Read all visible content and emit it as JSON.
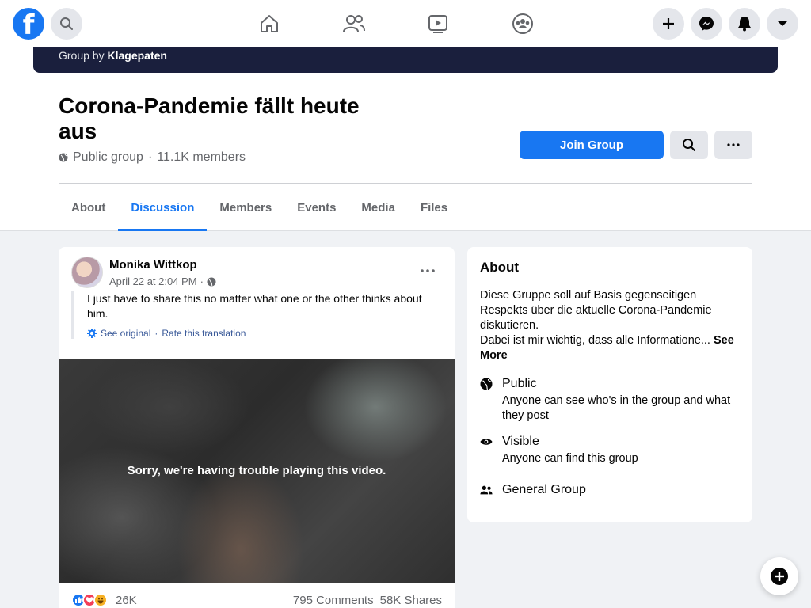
{
  "topbar": {
    "logo_letter": "f",
    "nav": [
      "home-icon",
      "friends-icon",
      "watch-icon",
      "groups-icon"
    ],
    "right": [
      "create-icon",
      "messenger-icon",
      "notifications-icon",
      "account-menu-icon"
    ]
  },
  "group": {
    "by_label": "Group by",
    "by_name": "Klagepaten",
    "title": "Corona-Pandemie fällt heute aus",
    "privacy": "Public group",
    "separator": "·",
    "members": "11.1K members",
    "join_label": "Join Group"
  },
  "tabs": [
    {
      "label": "About"
    },
    {
      "label": "Discussion",
      "active": true
    },
    {
      "label": "Members"
    },
    {
      "label": "Events"
    },
    {
      "label": "Media"
    },
    {
      "label": "Files"
    }
  ],
  "post": {
    "author": "Monika Wittkop",
    "time": "April 22 at 2:04 PM",
    "time_sep": "·",
    "text": "I just have to share this no matter what one or the other thinks about him.",
    "see_original": "See original",
    "translate_sep": "·",
    "rate_translation": "Rate this translation",
    "video_error": "Sorry, we're having trouble playing this video.",
    "reaction_count": "26K",
    "comments": "795 Comments",
    "shares": "58K Shares"
  },
  "about": {
    "title": "About",
    "description": "Diese Gruppe soll auf Basis gegenseitigen Respekts über die aktuelle Corona-Pandemie diskutieren.",
    "description_2": "Dabei ist mir wichtig, dass alle Informatione...",
    "see_more": "See More",
    "public_title": "Public",
    "public_sub": "Anyone can see who's in the group and what they post",
    "visible_title": "Visible",
    "visible_sub": "Anyone can find this group",
    "type_title": "General Group"
  },
  "colors": {
    "brand": "#1877f2",
    "cover": "#1a1f3d"
  }
}
